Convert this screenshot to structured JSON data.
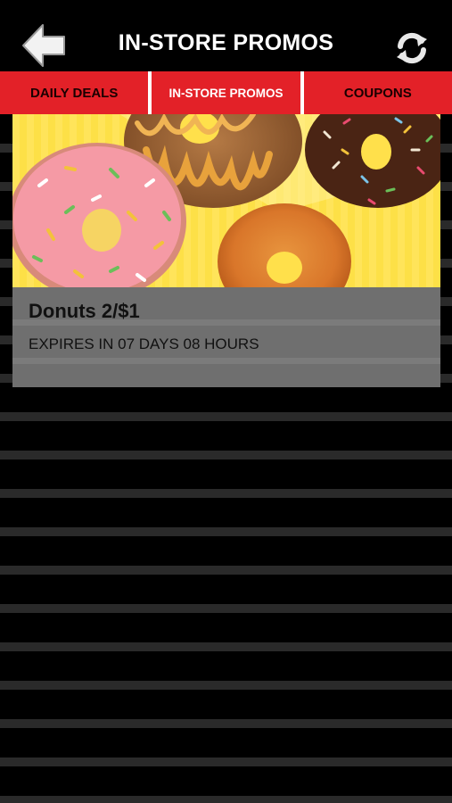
{
  "header": {
    "title": "IN-STORE PROMOS",
    "back_icon": "back-arrow-icon",
    "refresh_icon": "refresh-icon"
  },
  "tabs": [
    {
      "label": "DAILY DEALS",
      "active": false
    },
    {
      "label": "IN-STORE PROMOS",
      "active": true
    },
    {
      "label": "COUPONS",
      "active": false
    }
  ],
  "promo": {
    "title": "Donuts 2/$1",
    "expiry": "EXPIRES IN 07 DAYS 08 HOURS"
  },
  "colors": {
    "tab_bar": "#e32128",
    "background": "#000000",
    "card_body": "#6f6f6f",
    "image_background": "#ffe04b"
  }
}
